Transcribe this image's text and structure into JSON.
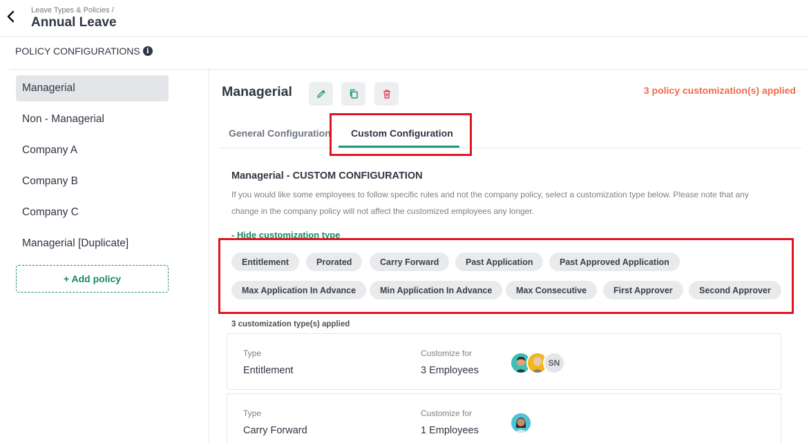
{
  "header": {
    "breadcrumb": "Leave Types & Policies /",
    "title": "Annual Leave"
  },
  "sidebar": {
    "section_title": "POLICY CONFIGURATIONS",
    "items": [
      {
        "label": "Managerial"
      },
      {
        "label": "Non - Managerial"
      },
      {
        "label": "Company A"
      },
      {
        "label": "Company B"
      },
      {
        "label": "Company C"
      },
      {
        "label": "Managerial [Duplicate]"
      }
    ],
    "add_label": "+ Add policy"
  },
  "policy": {
    "name": "Managerial",
    "applied_summary": "3 policy customization(s) applied",
    "tabs": [
      {
        "label": "General Configuration"
      },
      {
        "label": "Custom Configuration"
      }
    ]
  },
  "custom": {
    "title": "Managerial - CUSTOM CONFIGURATION",
    "description": "If you would like some employees to follow specific rules and not the company policy, select a customization type below. Please note that any change in the company policy will not affect the customized employees any longer.",
    "hide_link": "- Hide customization type",
    "chips": [
      "Entitlement",
      "Prorated",
      "Carry Forward",
      "Past Application",
      "Past Approved Application",
      "Max Application In Advance",
      "Min Application In Advance",
      "Max Consecutive",
      "First Approver",
      "Second Approver"
    ],
    "applied_count": "3 customization type(s) applied",
    "cards": [
      {
        "type_label": "Type",
        "type_value": "Entitlement",
        "for_label": "Customize for",
        "for_value": "3 Employees",
        "avatar_initials": "SN"
      },
      {
        "type_label": "Type",
        "type_value": "Carry Forward",
        "for_label": "Customize for",
        "for_value": "1 Employees"
      }
    ]
  },
  "colors": {
    "accent_green": "#1a9a73",
    "warning_orange": "#f26a4b",
    "highlight_red": "#e0141e"
  }
}
